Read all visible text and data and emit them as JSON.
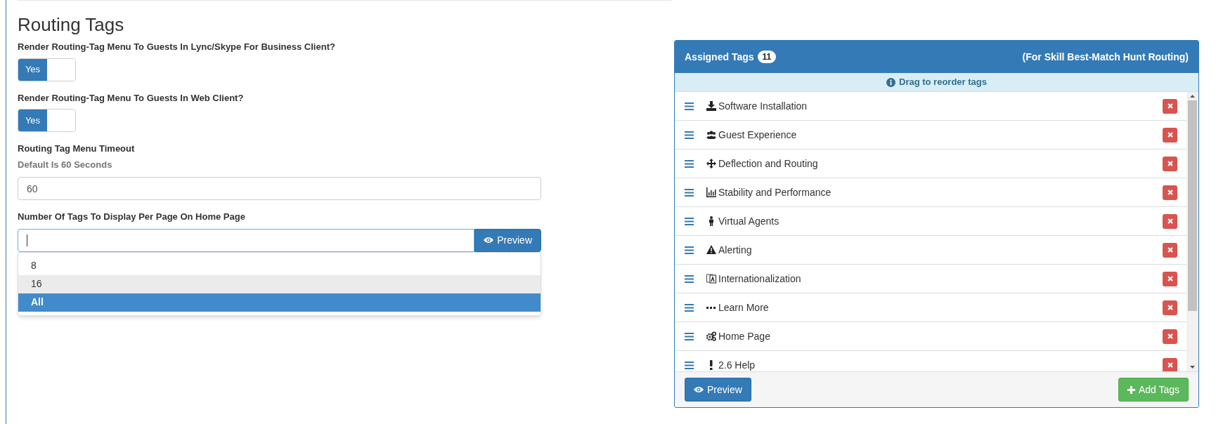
{
  "title": "Routing Tags",
  "toggles": [
    {
      "label": "Render Routing-Tag Menu To Guests In Lync/Skype For Business Client?",
      "on_label": "Yes",
      "on": true
    },
    {
      "label": "Render Routing-Tag Menu To Guests In Web Client?",
      "on_label": "Yes",
      "on": true
    }
  ],
  "timeout": {
    "label": "Routing Tag Menu Timeout",
    "help": "Default Is 60 Seconds",
    "value": "60"
  },
  "tags_per_page": {
    "label": "Number Of Tags To Display Per Page On Home Page",
    "button": "Preview",
    "options": [
      {
        "label": "8",
        "selected": false,
        "hovered": false
      },
      {
        "label": "16",
        "selected": false,
        "hovered": true
      },
      {
        "label": "All",
        "selected": true,
        "hovered": false
      }
    ]
  },
  "assigned_tags": {
    "title": "Assigned Tags",
    "count": "11",
    "subtitle": "(For Skill Best-Match Hunt Routing)",
    "hint": "Drag to reorder tags",
    "tags": [
      {
        "label": "Software Installation"
      },
      {
        "label": "Guest Experience"
      },
      {
        "label": "Deflection and Routing"
      },
      {
        "label": "Stability and Performance"
      },
      {
        "label": "Virtual Agents"
      },
      {
        "label": "Alerting"
      },
      {
        "label": "Internationalization"
      },
      {
        "label": "Learn More"
      },
      {
        "label": "Home Page"
      },
      {
        "label": "2.6 Help"
      }
    ],
    "preview_button": "Preview",
    "add_button": "Add Tags"
  }
}
